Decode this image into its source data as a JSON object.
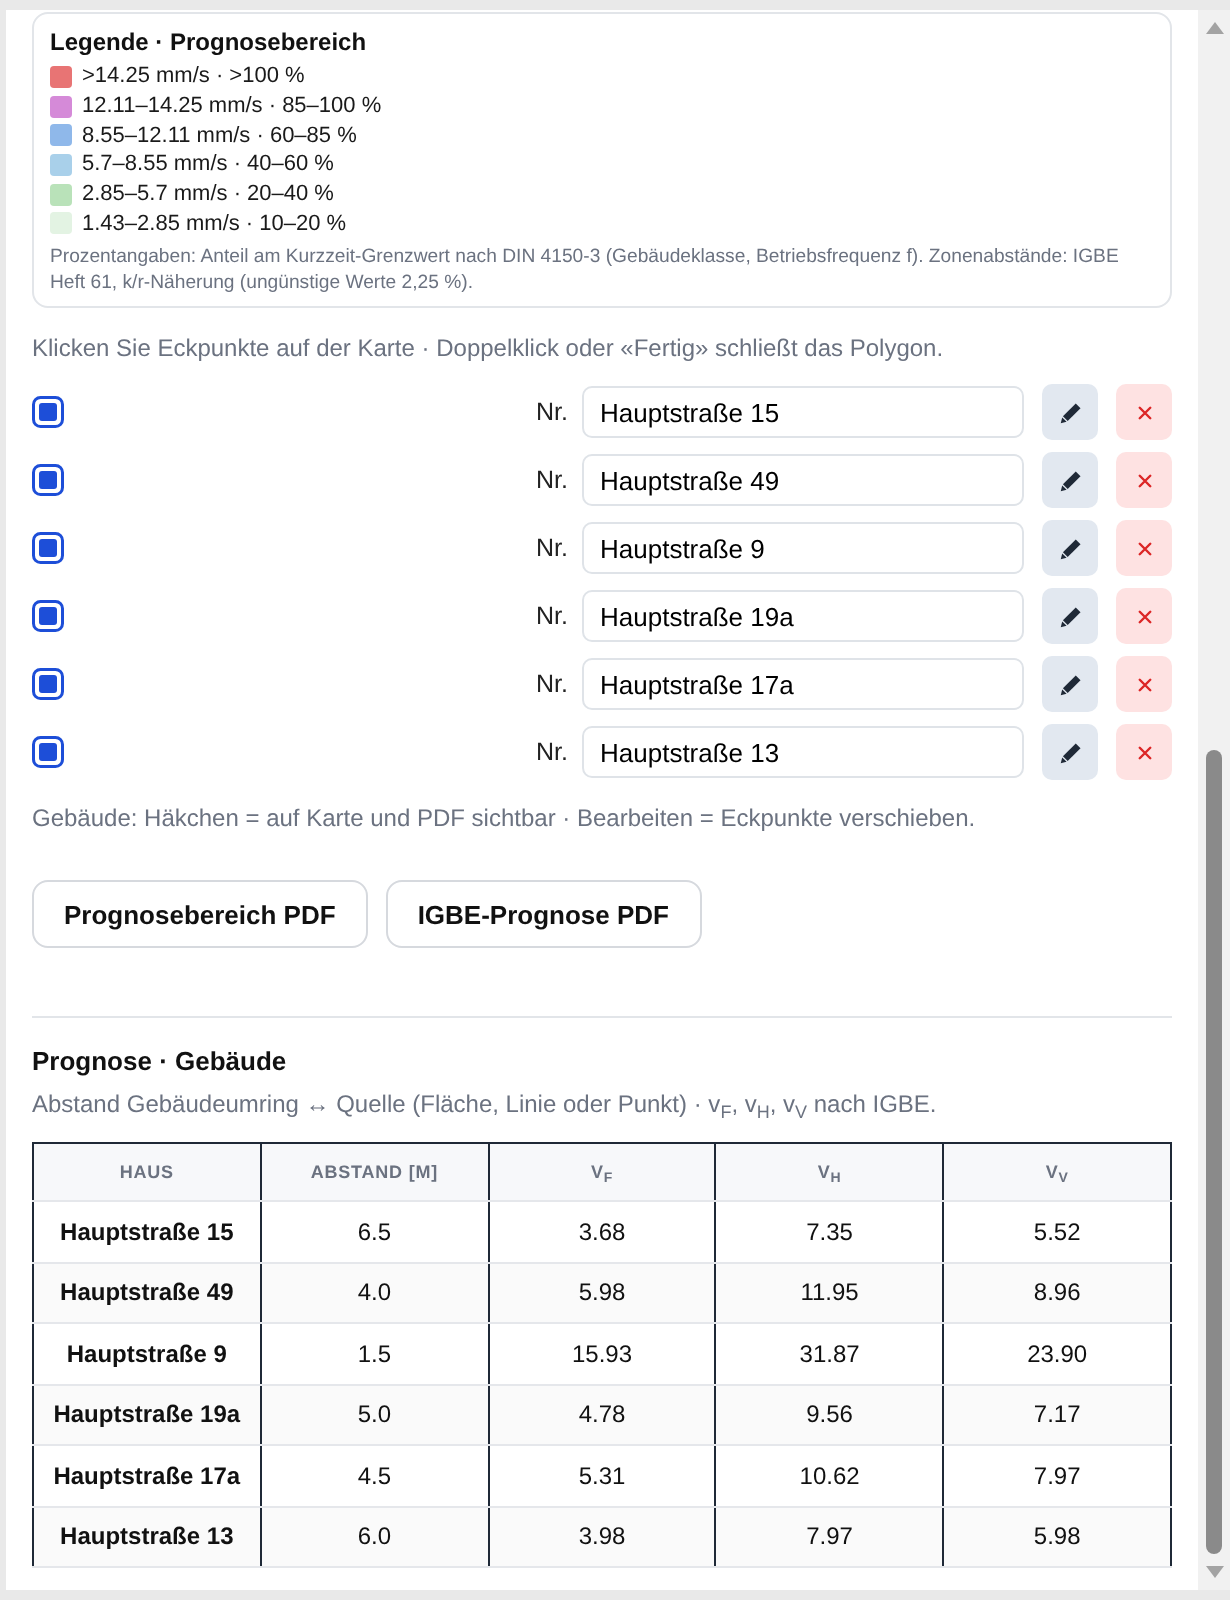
{
  "legend": {
    "title": "Legende · Prognosebereich",
    "items": [
      {
        "label": ">14.25 mm/s · >100 %",
        "color": "#e87474"
      },
      {
        "label": "12.11–14.25 mm/s · 85–100 %",
        "color": "#d58ad8"
      },
      {
        "label": "8.55–12.11 mm/s · 60–85 %",
        "color": "#8fb8ea"
      },
      {
        "label": "5.7–8.55 mm/s · 40–60 %",
        "color": "#a9d0ea"
      },
      {
        "label": "2.85–5.7 mm/s · 20–40 %",
        "color": "#b9e2b9"
      },
      {
        "label": "1.43–2.85 mm/s · 10–20 %",
        "color": "#e3f3e3"
      }
    ],
    "note": "Prozentangaben: Anteil am Kurzzeit-Grenzwert nach DIN 4150-3 (Gebäudeklasse, Betriebsfrequenz f). Zonenabstände: IGBE Heft 61, k/r-Näherung (ungünstige Werte 2,25 %)."
  },
  "instruction": "Klicken Sie Eckpunkte auf der Karte · Doppelklick oder «Fertig» schließt das Polygon.",
  "buildings": [
    {
      "checked": true,
      "label": "Nr.",
      "name": "Hauptstraße 15"
    },
    {
      "checked": true,
      "label": "Nr.",
      "name": "Hauptstraße 49"
    },
    {
      "checked": true,
      "label": "Nr.",
      "name": "Hauptstraße 9"
    },
    {
      "checked": true,
      "label": "Nr.",
      "name": "Hauptstraße 19a"
    },
    {
      "checked": true,
      "label": "Nr.",
      "name": "Hauptstraße 17a"
    },
    {
      "checked": true,
      "label": "Nr.",
      "name": "Hauptstraße 13"
    }
  ],
  "buildings_note": "Gebäude: Häkchen = auf Karte und PDF sichtbar · Bearbeiten = Eckpunkte verschieben.",
  "buttons": [
    "Prognosebereich PDF",
    "IGBE-Prognose PDF"
  ],
  "forecast": {
    "title": "Prognose · Gebäude",
    "subtitle": "Abstand Gebäudeumring ↔ Quelle (Fläche, Linie oder Punkt) · v$_{F}$, v$_{H}$, v$_{V}$ nach IGBE.",
    "table": {
      "columns": [
        "HAUS",
        "ABSTAND [M]",
        "V$_{F}$",
        "V$_{H}$",
        "V$_{V}$"
      ],
      "rows": [
        [
          "Hauptstraße 15",
          "6.5",
          "3.68",
          "7.35",
          "5.52"
        ],
        [
          "Hauptstraße 49",
          "4.0",
          "5.98",
          "11.95",
          "8.96"
        ],
        [
          "Hauptstraße 9",
          "1.5",
          "15.93",
          "31.87",
          "23.90"
        ],
        [
          "Hauptstraße 19a",
          "5.0",
          "4.78",
          "9.56",
          "7.17"
        ],
        [
          "Hauptstraße 17a",
          "4.5",
          "5.31",
          "10.62",
          "7.97"
        ],
        [
          "Hauptstraße 13",
          "6.0",
          "3.98",
          "7.97",
          "5.98"
        ]
      ]
    }
  }
}
